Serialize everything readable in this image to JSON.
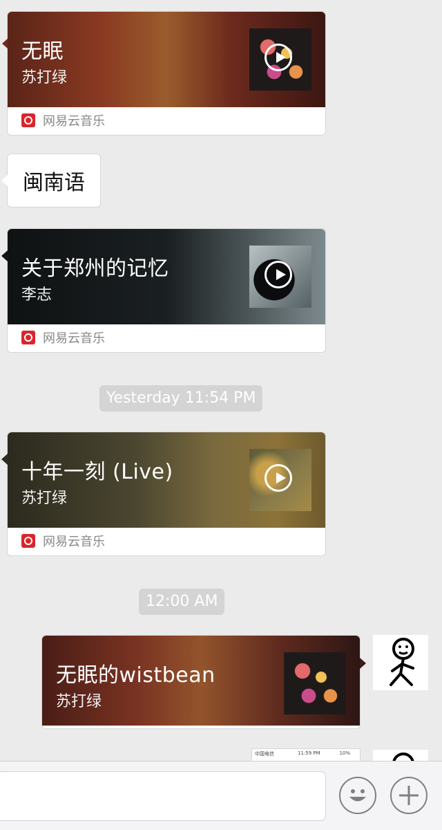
{
  "source_label": "网易云音乐",
  "colors": {
    "background": "#ebebeb",
    "netease_red": "#d8262c",
    "timestamp_pill": "#d4d4d4"
  },
  "messages": [
    {
      "kind": "music",
      "side": "left",
      "title": "无眠",
      "artist": "苏打绿",
      "cover": "fever-album",
      "play": true
    },
    {
      "kind": "text",
      "side": "left",
      "text": "闽南语"
    },
    {
      "kind": "music",
      "side": "left",
      "title": "关于郑州的记忆",
      "artist": "李志",
      "cover": "dark-portrait",
      "play": true
    },
    {
      "kind": "timestamp",
      "text": "Yesterday 11:54 PM"
    },
    {
      "kind": "music",
      "side": "left",
      "title": "十年一刻 (Live)",
      "artist": "苏打绿",
      "cover": "golden-album",
      "play": true
    },
    {
      "kind": "timestamp",
      "text": "12:00 AM"
    },
    {
      "kind": "music",
      "side": "right",
      "title": "无眠的wistbean",
      "artist": "苏打绿",
      "cover": "fever-album",
      "play": false,
      "avatar": "stick-figure-avatar"
    },
    {
      "kind": "image",
      "side": "right",
      "content": "screenshot-thumbnail",
      "avatar": "stick-figure-avatar"
    }
  ],
  "thumbnail": {
    "carrier": "中国电信",
    "time": "11:59 PM",
    "battery": "10%"
  },
  "input_bar": {
    "placeholder": "",
    "emoji_icon": "smiley-icon",
    "plus_icon": "plus-icon"
  }
}
